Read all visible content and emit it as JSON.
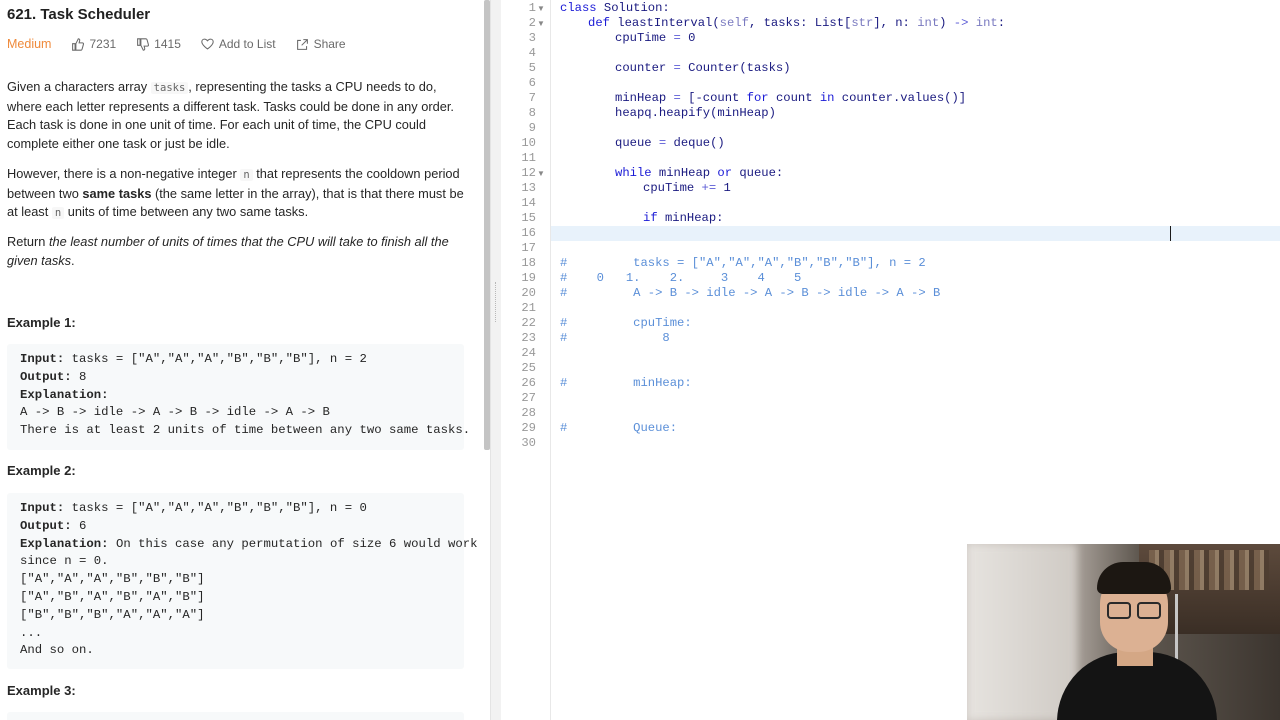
{
  "problem": {
    "title": "621. Task Scheduler",
    "difficulty": "Medium",
    "likes": "7231",
    "dislikes": "1415",
    "add_to_list": "Add to List",
    "share": "Share"
  },
  "description": {
    "p1_a": "Given a characters array ",
    "p1_code": "tasks",
    "p1_b": ", representing the tasks a CPU needs to do, where each letter represents a different task. Tasks could be done in any order. Each task is done in one unit of time. For each unit of time, the CPU could complete either one task or just be idle.",
    "p2_a": "However, there is a non-negative integer ",
    "p2_code1": "n",
    "p2_b": " that represents the cooldown period between two ",
    "p2_bold": "same tasks",
    "p2_c": " (the same letter in the array), that is that there must be at least ",
    "p2_code2": "n",
    "p2_d": " units of time between any two same tasks.",
    "p3_a": "Return ",
    "p3_italic": "the least number of units of times that the CPU will take to finish all the given tasks",
    "p3_b": "."
  },
  "examples": [
    {
      "title": "Example 1:",
      "input_label": "Input:",
      "input": " tasks = [\"A\",\"A\",\"A\",\"B\",\"B\",\"B\"], n = 2",
      "output_label": "Output:",
      "output": " 8",
      "explanation_label": "Explanation:",
      "explanation": "",
      "lines": [
        "A -> B -> idle -> A -> B -> idle -> A -> B",
        "There is at least 2 units of time between any two same tasks."
      ]
    },
    {
      "title": "Example 2:",
      "input_label": "Input:",
      "input": " tasks = [\"A\",\"A\",\"A\",\"B\",\"B\",\"B\"], n = 0",
      "output_label": "Output:",
      "output": " 6",
      "explanation_label": "Explanation:",
      "explanation": " On this case any permutation of size 6 would work",
      "lines": [
        "since n = 0.",
        "[\"A\",\"A\",\"A\",\"B\",\"B\",\"B\"]",
        "[\"A\",\"B\",\"A\",\"B\",\"A\",\"B\"]",
        "[\"B\",\"B\",\"B\",\"A\",\"A\",\"A\"]",
        "...",
        "And so on."
      ]
    },
    {
      "title": "Example 3:"
    }
  ],
  "editor": {
    "line_numbers": [
      "1",
      "2",
      "3",
      "4",
      "5",
      "6",
      "7",
      "8",
      "9",
      "10",
      "11",
      "12",
      "13",
      "14",
      "15",
      "16",
      "17",
      "18",
      "19",
      "20",
      "21",
      "22",
      "23",
      "24",
      "25",
      "26",
      "27",
      "28",
      "29",
      "30"
    ],
    "code": {
      "l1_kw": "class",
      "l1_name": " Solution:",
      "l2_kw": "def",
      "l2_a": " leastInterval(",
      "l2_self": "self",
      "l2_b": ", tasks: List[",
      "l2_str": "str",
      "l2_c": "], n: ",
      "l2_int": "int",
      "l2_d": ") ",
      "l2_arrow": "->",
      "l2_e": " ",
      "l2_int2": "int",
      "l2_f": ":",
      "l3_a": "cpuTime ",
      "l3_op": "=",
      "l3_b": " 0",
      "l5_a": "counter ",
      "l5_op": "=",
      "l5_b": " Counter(tasks)",
      "l7_a": "minHeap ",
      "l7_op": "=",
      "l7_b": " [-count ",
      "l7_for": "for",
      "l7_c": " count ",
      "l7_in": "in",
      "l7_d": " counter.values()]",
      "l8": "heapq.heapify(minHeap)",
      "l10_a": "queue ",
      "l10_op": "=",
      "l10_b": " deque()",
      "l12_kw": "while",
      "l12_a": " minHeap ",
      "l12_or": "or",
      "l12_b": " queue:",
      "l13_a": "cpuTime ",
      "l13_op": "+=",
      "l13_b": " 1",
      "l15_kw": "if",
      "l15_a": " minHeap:",
      "l18": "#         tasks = [\"A\",\"A\",\"A\",\"B\",\"B\",\"B\"], n = 2",
      "l19": "#    0   1.    2.     3    4    5",
      "l20": "#         A -> B -> idle -> A -> B -> idle -> A -> B",
      "l22": "#         cpuTime:",
      "l23": "#             8",
      "l26": "#         minHeap:",
      "l29": "#         Queue:"
    }
  }
}
